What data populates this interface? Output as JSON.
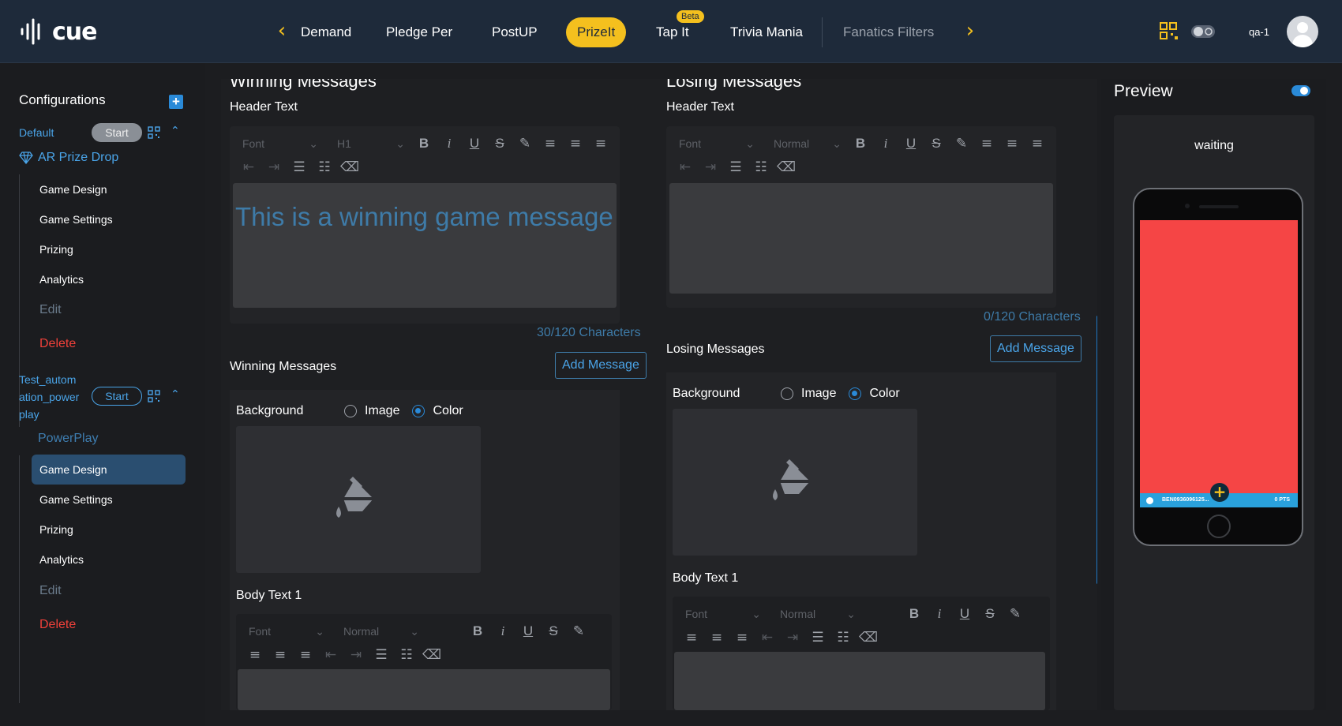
{
  "app": {
    "brand": "cue",
    "user": "qa-1"
  },
  "nav": {
    "items": [
      {
        "label": "Demand"
      },
      {
        "label": "Pledge Per"
      },
      {
        "label": "PostUP"
      },
      {
        "label": "PrizeIt",
        "active": true
      },
      {
        "label": "Tap It",
        "badge": "Beta"
      },
      {
        "label": "Trivia Mania"
      },
      {
        "label": "Fanatics Filters"
      }
    ],
    "prev_icon": "chevron-left-icon",
    "next_icon": "chevron-right-icon"
  },
  "sidebar": {
    "title": "Configurations",
    "configs": [
      {
        "name": "Default",
        "start_label": "Start",
        "game_type": "AR Prize Drop",
        "items": [
          "Game Design",
          "Game Settings",
          "Prizing",
          "Analytics"
        ],
        "edit_label": "Edit",
        "delete_label": "Delete"
      },
      {
        "name_line1": "Test_autom",
        "name_line2": "ation_power",
        "name_line3": "play",
        "start_label": "Start",
        "game_type": "PowerPlay",
        "items": [
          "Game Design",
          "Game Settings",
          "Prizing",
          "Analytics"
        ],
        "active_item": "Game Design",
        "edit_label": "Edit",
        "delete_label": "Delete"
      }
    ]
  },
  "winning": {
    "section_title": "Winning Messages",
    "header_label": "Header Text",
    "font_placeholder": "Font",
    "header_style": "H1",
    "header_value": "This is a winning game message",
    "counter": "30/120 Characters",
    "messages_label": "Winning Messages",
    "add_button": "Add Message",
    "background_label": "Background",
    "image_option": "Image",
    "color_option": "Color",
    "selected_option": "Color",
    "body_label": "Body Text 1",
    "body_font_placeholder": "Font",
    "body_style": "Normal"
  },
  "losing": {
    "section_title": "Losing Messages",
    "header_label": "Header Text",
    "font_placeholder": "Font",
    "header_style": "Normal",
    "header_value": "",
    "counter": "0/120 Characters",
    "messages_label": "Losing Messages",
    "add_button": "Add Message",
    "background_label": "Background",
    "image_option": "Image",
    "color_option": "Color",
    "selected_option": "Color",
    "body_label": "Body Text 1",
    "body_font_placeholder": "Font",
    "body_style": "Normal"
  },
  "preview": {
    "title": "Preview",
    "status": "waiting",
    "screen_color": "#f54545",
    "bar_id": "BEN0936096125...",
    "bar_points": "0 PTS"
  },
  "colors": {
    "accent": "#f4c01e",
    "link": "#4aa4e8",
    "danger": "#f0413a",
    "topbar": "#1e2a3a"
  }
}
